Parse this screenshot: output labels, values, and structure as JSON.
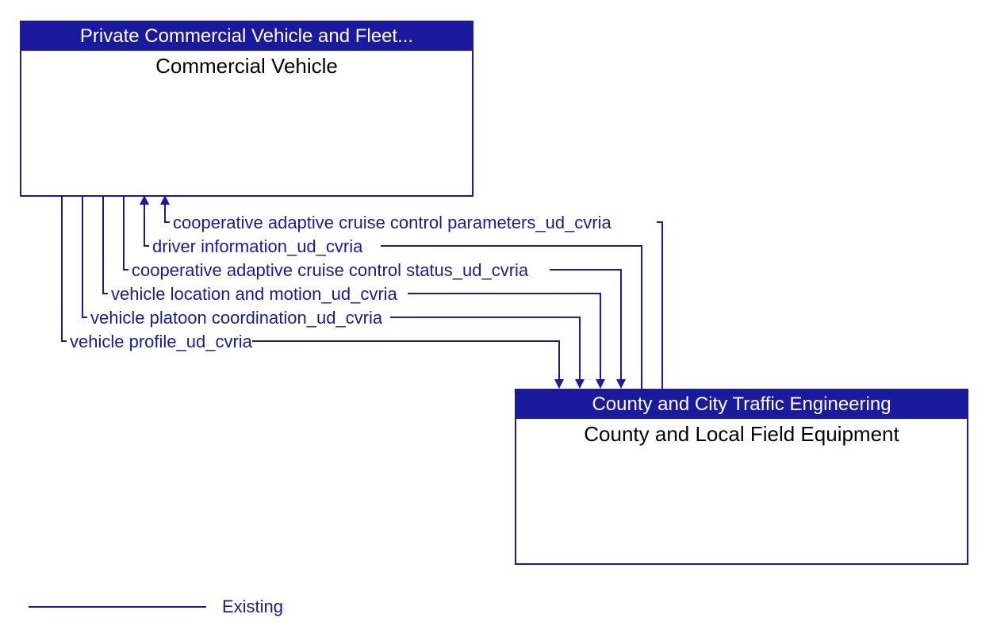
{
  "boxes": {
    "source": {
      "header": "Private Commercial Vehicle and Fleet...",
      "body": "Commercial Vehicle"
    },
    "target": {
      "header": "County and City Traffic Engineering",
      "body": "County and Local Field Equipment"
    }
  },
  "flows": [
    "cooperative adaptive cruise control parameters_ud_cvria",
    "driver information_ud_cvria",
    "cooperative adaptive cruise control status_ud_cvria",
    "vehicle location and motion_ud_cvria",
    "vehicle platoon coordination_ud_cvria",
    "vehicle profile_ud_cvria"
  ],
  "legend": {
    "existing": "Existing"
  }
}
